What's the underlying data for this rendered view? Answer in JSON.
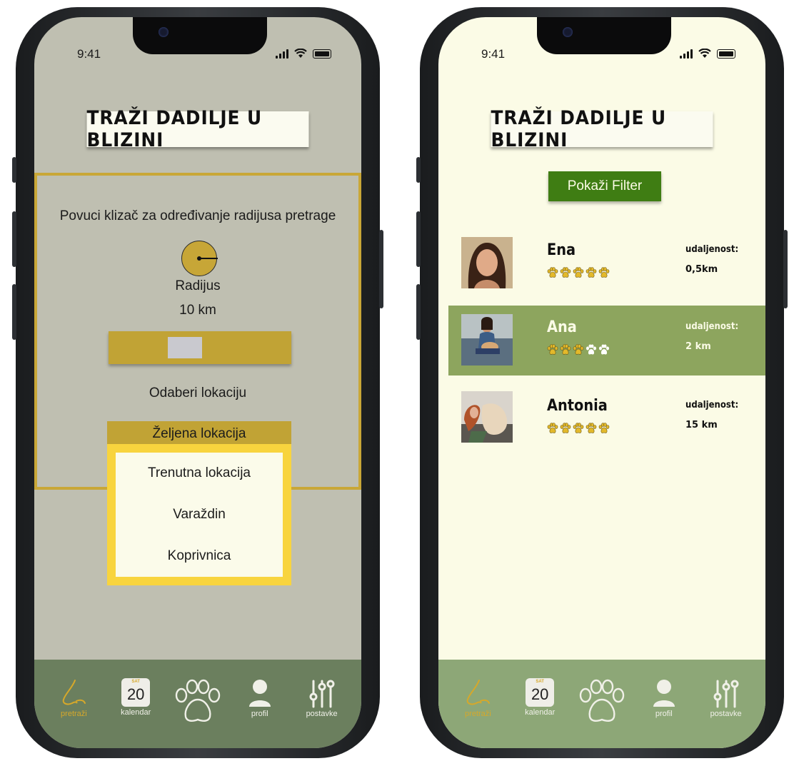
{
  "status_bar": {
    "time": "9:41"
  },
  "left_screen": {
    "title": "TRAŽI DADILJE U BLIZINI",
    "slider_hint": "Povuci klizač za određivanje radijusa pretrage",
    "radius_label": "Radijus",
    "radius_value": "10 km",
    "radius_slider_value_fraction": 0.4,
    "location_label": "Odaberi lokaciju",
    "location_select_value": "Željena lokacija",
    "location_options": [
      "Trenutna lokacija",
      "Varaždin",
      "Koprivnica"
    ]
  },
  "right_screen": {
    "title": "TRAŽI DADILJE U BLIZINI",
    "filter_button": "Pokaži Filter",
    "distance_label": "udaljenost:",
    "sitters": [
      {
        "name": "Ena",
        "distance": "0,5km",
        "rating": 5
      },
      {
        "name": "Ana",
        "distance": "2 km",
        "rating": 3
      },
      {
        "name": "Antonia",
        "distance": "15 km",
        "rating": 5
      }
    ]
  },
  "nav": {
    "items": [
      {
        "label": "pretraži",
        "icon": "nose-icon"
      },
      {
        "label": "kalendar",
        "icon": "calendar-icon",
        "day": "20",
        "month": "SAT"
      },
      {
        "label": "",
        "icon": "paw-icon"
      },
      {
        "label": "profil",
        "icon": "person-icon"
      },
      {
        "label": "postavke",
        "icon": "sliders-icon"
      }
    ]
  },
  "colors": {
    "left_bg": "#bfbfb1",
    "right_bg": "#fbfbe6",
    "gold": "#c1a335",
    "dropdown_border": "#f8d43e",
    "nav_dark": "#6b7f5e",
    "nav_light": "#8da777",
    "filter_green": "#3f7d13",
    "highlight_row": "#8da55e"
  }
}
